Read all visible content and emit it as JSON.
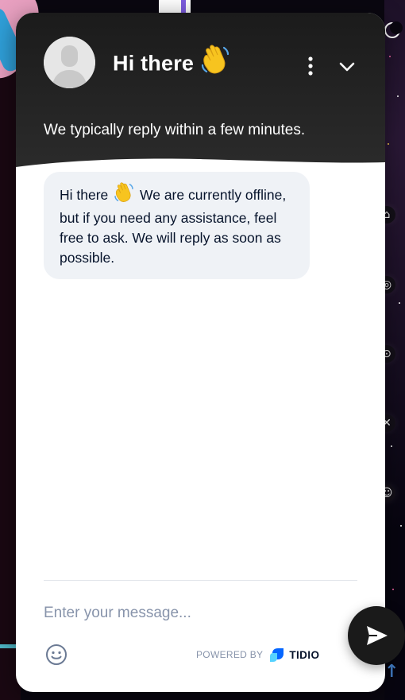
{
  "header": {
    "title": "Hi there",
    "title_emoji": "waving-hand-icon",
    "subtitle": "We typically reply within a few minutes.",
    "background_color": "#1b1b1b",
    "menu_icon": "more-vertical-icon",
    "collapse_icon": "chevron-down-icon"
  },
  "messages": [
    {
      "sender": "operator",
      "text_before_emoji": "Hi there",
      "emoji": "waving-hand-icon",
      "text_after_emoji": " We are currently offline, but if you need any assistance, feel free to ask. We will reply as soon as possible."
    }
  ],
  "composer": {
    "placeholder": "Enter your message...",
    "emoji_icon": "smiley-icon",
    "send_icon": "send-icon"
  },
  "branding": {
    "powered_by": "POWERED BY",
    "name": "TIDIO",
    "accent_color": "#0566ff"
  },
  "colors": {
    "bubble_bg": "#eff2f6",
    "text_dark": "#06132b",
    "muted": "#8894ab"
  }
}
